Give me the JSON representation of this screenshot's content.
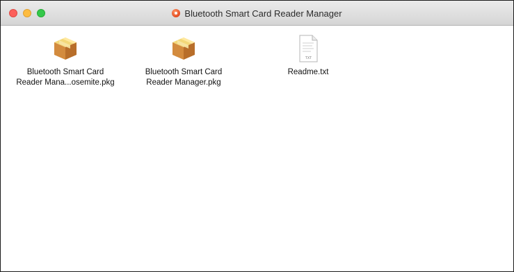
{
  "window": {
    "title": "Bluetooth Smart Card Reader Manager"
  },
  "items": [
    {
      "label": "Bluetooth Smart Card\nReader Mana...osemite.pkg",
      "icon": "package-icon"
    },
    {
      "label": "Bluetooth Smart Card\nReader Manager.pkg",
      "icon": "package-icon"
    },
    {
      "label": "Readme.txt",
      "icon": "text-document-icon",
      "badge": "TXT"
    }
  ],
  "colors": {
    "close": "#fc605b",
    "minimize": "#fdbc40",
    "zoom": "#34c84a",
    "package": "#c9873c"
  }
}
